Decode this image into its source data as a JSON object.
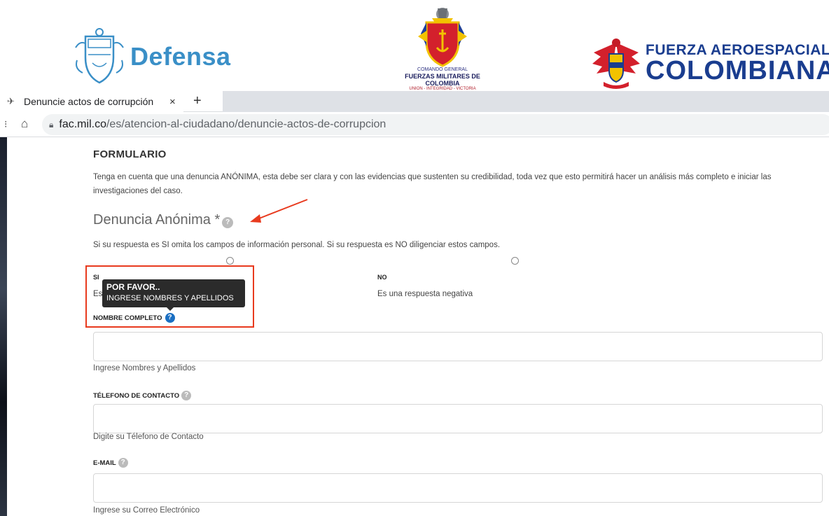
{
  "logos": {
    "defensa": {
      "word": "Defensa"
    },
    "cgfm": {
      "line1": "COMANDO GENERAL",
      "line2": "FUERZAS MILITARES DE COLOMBIA",
      "line3": "UNION - INTEGRIDAD - VICTORIA"
    },
    "fac": {
      "line1": "FUERZA AEROESPACIAL",
      "line2": "COLOMBIANA"
    }
  },
  "browser": {
    "tab_title": "Denuncie actos de corrupción",
    "close_glyph": "×",
    "new_tab_glyph": "+",
    "url_host": "fac.mil.co",
    "url_path": "/es/atencion-al-ciudadano/denuncie-actos-de-corrupcion"
  },
  "form": {
    "title": "FORMULARIO",
    "intro": "Tenga en cuenta que una denuncia ANÓNIMA, esta debe ser clara y con las evidencias que sustenten su credibilidad, toda vez que esto permitirá hacer un análisis más completo e iniciar las investigaciones del caso.",
    "anon_heading": "Denuncia Anónima *",
    "anon_note": "Si su respuesta es SI omita los campos de información personal. Si su respuesta es NO diligenciar estos campos.",
    "options": [
      {
        "label": "SI",
        "desc_peek": "Es"
      },
      {
        "label": "NO",
        "desc": "Es una respuesta negativa"
      }
    ],
    "tooltip": {
      "title": "POR FAVOR..",
      "body": "INGRESE NOMBRES Y APELLIDOS"
    },
    "fields": [
      {
        "label": "NOMBRE COMPLETO",
        "hint": "Ingrese Nombres y Apellidos"
      },
      {
        "label": "TÉLEFONO DE CONTACTO",
        "hint": "Digite su Télefono de Contacto"
      },
      {
        "label": "E-MAIL",
        "hint": "Ingrese su Correo Electrónico"
      }
    ],
    "help_glyph": "?"
  },
  "colors": {
    "annotation_red": "#e83a1e",
    "help_blue": "#1b6fc2",
    "defensa_blue": "#3a8fc7",
    "fac_blue": "#1a3d8f"
  }
}
